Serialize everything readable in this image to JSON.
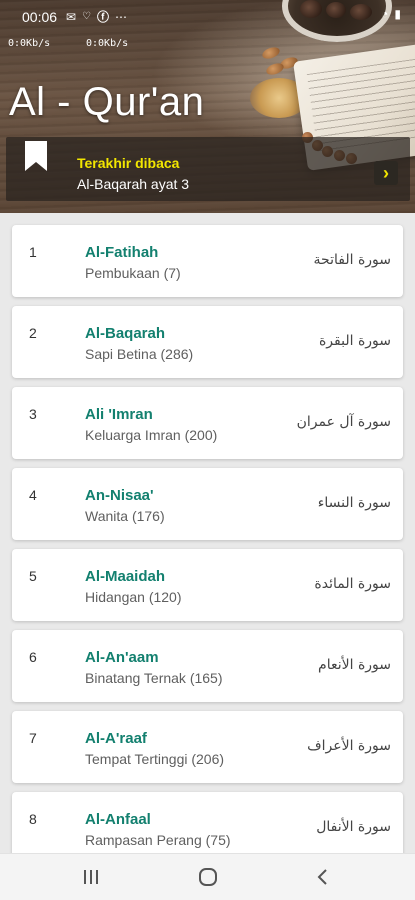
{
  "status_bar": {
    "time": "00:06",
    "speeds": [
      "0:0Kb/s",
      "0:0Kb/s"
    ]
  },
  "header": {
    "title": "Al - Qur'an"
  },
  "last_read": {
    "title": "Terakhir dibaca",
    "subtitle": "Al-Baqarah ayat 3",
    "arrow": "›"
  },
  "surahs": [
    {
      "number": "1",
      "name": "Al-Fatihah",
      "meaning": "Pembukaan (7)",
      "arabic": "سورة الفاتحة"
    },
    {
      "number": "2",
      "name": "Al-Baqarah",
      "meaning": "Sapi Betina (286)",
      "arabic": "سورة البقرة"
    },
    {
      "number": "3",
      "name": "Ali 'Imran",
      "meaning": "Keluarga Imran (200)",
      "arabic": "سورة آل عمران"
    },
    {
      "number": "4",
      "name": "An-Nisaa'",
      "meaning": "Wanita (176)",
      "arabic": "سورة النساء"
    },
    {
      "number": "5",
      "name": "Al-Maaidah",
      "meaning": "Hidangan (120)",
      "arabic": "سورة المائدة"
    },
    {
      "number": "6",
      "name": "Al-An'aam",
      "meaning": "Binatang Ternak (165)",
      "arabic": "سورة الأنعام"
    },
    {
      "number": "7",
      "name": "Al-A'raaf",
      "meaning": "Tempat Tertinggi (206)",
      "arabic": "سورة الأعراف"
    },
    {
      "number": "8",
      "name": "Al-Anfaal",
      "meaning": "Rampasan Perang (75)",
      "arabic": "سورة الأنفال"
    }
  ],
  "colors": {
    "accent_green": "#13806f",
    "highlight_yellow": "#f2e600"
  }
}
